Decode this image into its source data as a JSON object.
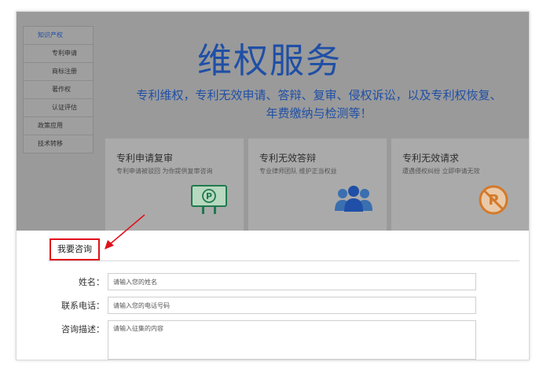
{
  "sidebar": {
    "items": [
      {
        "label": "知识产权",
        "level": 1,
        "active": true
      },
      {
        "label": "专利申请",
        "level": 2
      },
      {
        "label": "商标注册",
        "level": 2
      },
      {
        "label": "著作权",
        "level": 2
      },
      {
        "label": "认证评估",
        "level": 2
      },
      {
        "label": "政策应用",
        "level": 1
      },
      {
        "label": "技术转移",
        "level": 1
      }
    ]
  },
  "hero": {
    "title": "维权服务",
    "subtitle": "专利维权，专利无效申请、答辩、复审、侵权诉讼，以及专利权恢复、年费缴纳与检测等！"
  },
  "cards": [
    {
      "title": "专利申请复审",
      "desc": "专利申请被驳回 为你提供复审咨询",
      "icon": "patent-sign-icon"
    },
    {
      "title": "专利无效答辩",
      "desc": "专业律师团队 维护正当权益",
      "icon": "people-group-icon"
    },
    {
      "title": "专利无效请求",
      "desc": "遭遇侵权纠纷 立即申请无效",
      "icon": "no-patent-icon"
    }
  ],
  "consult": {
    "label": "我要咨询"
  },
  "form": {
    "name_label": "姓名：",
    "name_placeholder": "请输入您的姓名",
    "phone_label": "联系电话：",
    "phone_placeholder": "请输入您的电话号码",
    "desc_label": "咨询描述：",
    "desc_placeholder": "请输入征集的内容"
  },
  "colors": {
    "accent": "#1f4fa6",
    "highlight": "#e0101a",
    "overlay": "#9a9a9a"
  }
}
